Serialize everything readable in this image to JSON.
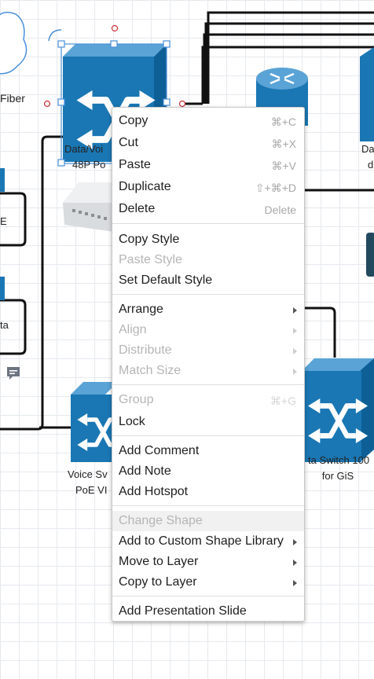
{
  "canvas": {
    "labels": {
      "fiber": "Fiber",
      "left_mid_top": "E",
      "left_mid_bottom": "ta",
      "selected_line1": "Data/Voi",
      "selected_line2": "48P Po",
      "right_top_line1": "Da",
      "right_top_line2": "d",
      "voice_line1": "Voice Sv",
      "voice_line2": "PoE VI",
      "data_switch_line1": "ta  Switch 100",
      "data_switch_line2": "for GiS"
    },
    "colors": {
      "switch_blue": "#1a77b4",
      "selection": "#4a90d9",
      "connector": "#111111"
    }
  },
  "context_menu": {
    "items": [
      {
        "label": "Copy",
        "shortcut": "⌘+C",
        "enabled": true,
        "submenu": false
      },
      {
        "label": "Cut",
        "shortcut": "⌘+X",
        "enabled": true,
        "submenu": false
      },
      {
        "label": "Paste",
        "shortcut": "⌘+V",
        "enabled": true,
        "submenu": false
      },
      {
        "label": "Duplicate",
        "shortcut": "⇧+⌘+D",
        "enabled": true,
        "submenu": false
      },
      {
        "label": "Delete",
        "shortcut": "Delete",
        "enabled": true,
        "submenu": false
      },
      {
        "label": "Copy Style",
        "shortcut": "",
        "enabled": true,
        "submenu": false
      },
      {
        "label": "Paste Style",
        "shortcut": "",
        "enabled": false,
        "submenu": false
      },
      {
        "label": "Set Default Style",
        "shortcut": "",
        "enabled": true,
        "submenu": false
      },
      {
        "label": "Arrange",
        "shortcut": "",
        "enabled": true,
        "submenu": true
      },
      {
        "label": "Align",
        "shortcut": "",
        "enabled": false,
        "submenu": true
      },
      {
        "label": "Distribute",
        "shortcut": "",
        "enabled": false,
        "submenu": true
      },
      {
        "label": "Match Size",
        "shortcut": "",
        "enabled": false,
        "submenu": true
      },
      {
        "label": "Group",
        "shortcut": "⌘+G",
        "enabled": false,
        "submenu": false
      },
      {
        "label": "Lock",
        "shortcut": "",
        "enabled": true,
        "submenu": false
      },
      {
        "label": "Add Comment",
        "shortcut": "",
        "enabled": true,
        "submenu": false
      },
      {
        "label": "Add Note",
        "shortcut": "",
        "enabled": true,
        "submenu": false
      },
      {
        "label": "Add Hotspot",
        "shortcut": "",
        "enabled": true,
        "submenu": false
      },
      {
        "label": "Change Shape",
        "shortcut": "",
        "enabled": false,
        "submenu": false,
        "highlighted": true
      },
      {
        "label": "Add to Custom Shape Library",
        "shortcut": "",
        "enabled": true,
        "submenu": true
      },
      {
        "label": "Move to Layer",
        "shortcut": "",
        "enabled": true,
        "submenu": true
      },
      {
        "label": "Copy to Layer",
        "shortcut": "",
        "enabled": true,
        "submenu": true
      },
      {
        "label": "Add Presentation Slide",
        "shortcut": "",
        "enabled": true,
        "submenu": false
      }
    ]
  }
}
